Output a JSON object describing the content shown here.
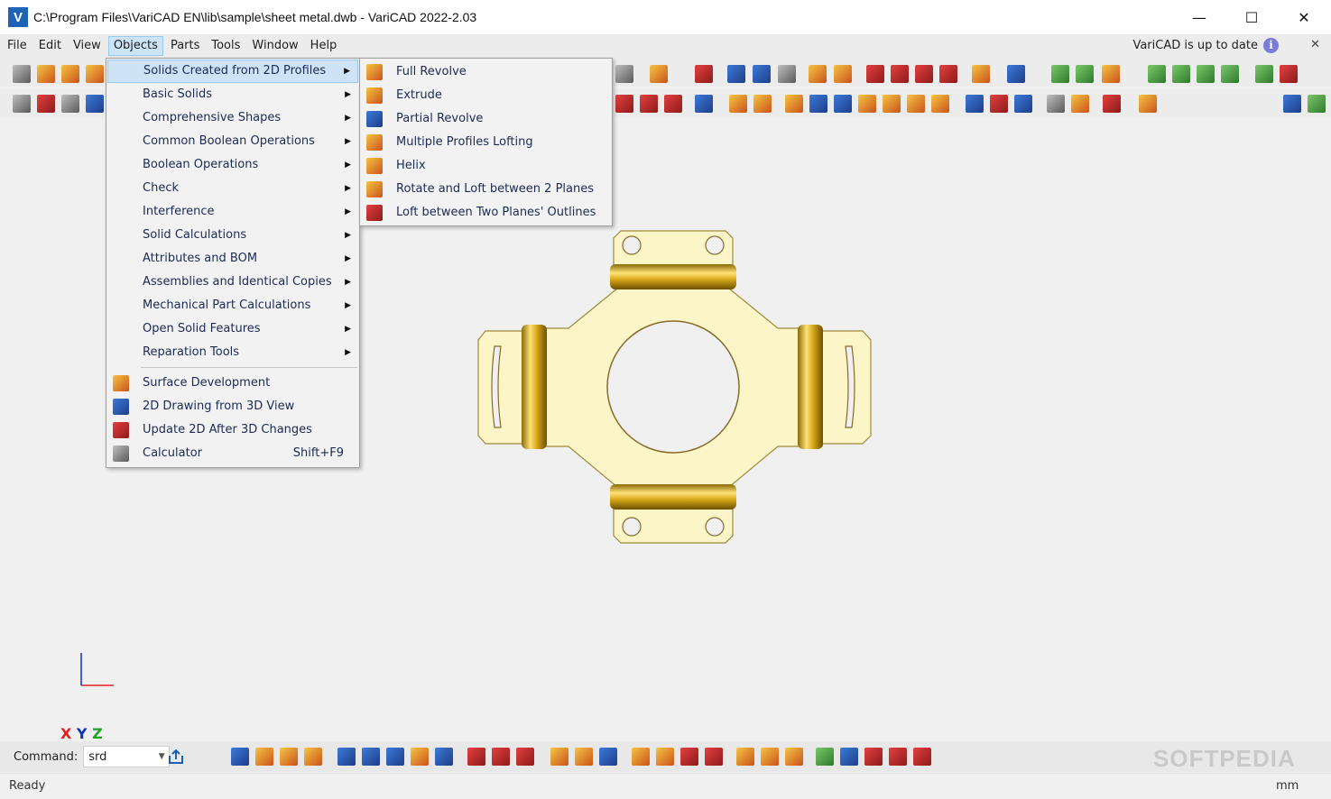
{
  "window": {
    "title": "C:\\Program Files\\VariCAD EN\\lib\\sample\\sheet metal.dwb - VariCAD 2022-2.03",
    "logo_letter": "V",
    "minimize_glyph": "—",
    "maximize_glyph": "☐",
    "close_glyph": "✕"
  },
  "menubar": {
    "items": [
      "File",
      "Edit",
      "View",
      "Objects",
      "Parts",
      "Tools",
      "Window",
      "Help"
    ],
    "active": "Objects",
    "update_notice": "VariCAD is up to date",
    "info_icon_glyph": "i",
    "close_glyph": "✕"
  },
  "objects_menu": {
    "items": [
      {
        "label": "Solids Created from 2D Profiles",
        "submenu": true,
        "highlighted": true
      },
      {
        "label": "Basic Solids",
        "submenu": true
      },
      {
        "label": "Comprehensive Shapes",
        "submenu": true
      },
      {
        "label": "Common Boolean Operations",
        "submenu": true
      },
      {
        "label": "Boolean Operations",
        "submenu": true
      },
      {
        "label": "Check",
        "submenu": true
      },
      {
        "label": "Interference",
        "submenu": true
      },
      {
        "label": "Solid Calculations",
        "submenu": true
      },
      {
        "label": "Attributes and BOM",
        "submenu": true
      },
      {
        "label": "Assemblies and Identical Copies",
        "submenu": true
      },
      {
        "label": "Mechanical Part Calculations",
        "submenu": true
      },
      {
        "label": "Open Solid Features",
        "submenu": true
      },
      {
        "label": "Reparation Tools",
        "submenu": true
      }
    ],
    "lower_items": [
      {
        "label": "Surface Development",
        "icon": "surface-development-icon"
      },
      {
        "label": "2D Drawing from 3D View",
        "icon": "drawing-from-3d-icon"
      },
      {
        "label": "Update 2D After 3D Changes",
        "icon": "update-2d-icon"
      },
      {
        "label": "Calculator",
        "icon": "calculator-icon",
        "shortcut": "Shift+F9"
      }
    ],
    "arrow_glyph": "▶"
  },
  "submenu": {
    "items": [
      {
        "label": "Full Revolve",
        "icon": "full-revolve-icon"
      },
      {
        "label": "Extrude",
        "icon": "extrude-icon"
      },
      {
        "label": "Partial Revolve",
        "icon": "partial-revolve-icon"
      },
      {
        "label": "Multiple Profiles Lofting",
        "icon": "lofting-icon"
      },
      {
        "label": "Helix",
        "icon": "helix-icon"
      },
      {
        "label": "Rotate and Loft between 2 Planes",
        "icon": "rotate-loft-icon"
      },
      {
        "label": "Loft between Two Planes' Outlines",
        "icon": "loft-outlines-icon"
      }
    ]
  },
  "axes": {
    "x_label": "X",
    "y_label": "Y",
    "z_label": "Z",
    "x_color": "#e02020",
    "y_color": "#1030c0",
    "z_color": "#20a020"
  },
  "command": {
    "label": "Command:",
    "value": "srd",
    "dropdown_glyph": "▼"
  },
  "status": {
    "text": "Ready",
    "units": "mm"
  },
  "watermark": "SOFTPEDIA",
  "colors": {
    "part_fill": "#fbf5c8",
    "part_stroke": "#a08a3a",
    "hinge_gold": "#d8a81a",
    "menu_highlight": "#cfe3f7"
  }
}
